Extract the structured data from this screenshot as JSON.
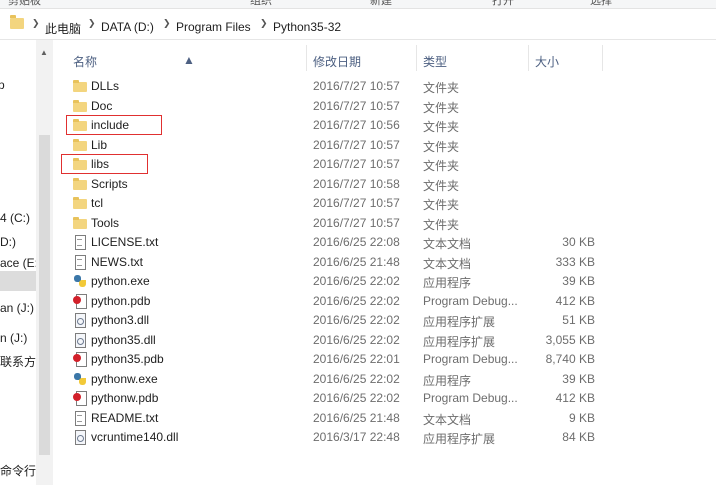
{
  "ribbon": {
    "groups": [
      "剪贴板",
      "组织",
      "新建",
      "打开",
      "选择"
    ]
  },
  "address_bar": {
    "folder_icon": "folder-icon",
    "breadcrumb": [
      "此电脑",
      "DATA (D:)",
      "Program Files",
      "Python35-32"
    ]
  },
  "nav_pane": {
    "items": [
      "p",
      "4 (C:)",
      "D:)",
      "ace (E:)",
      "an (J:)",
      "n (J:)",
      "联系方式",
      "命令行自"
    ]
  },
  "columns": {
    "name": "名称",
    "date": "修改日期",
    "type": "类型",
    "size": "大小"
  },
  "files": [
    {
      "name": "DLLs",
      "date": "2016/7/27 10:57",
      "type": "文件夹",
      "size": "",
      "icon": "folder"
    },
    {
      "name": "Doc",
      "date": "2016/7/27 10:57",
      "type": "文件夹",
      "size": "",
      "icon": "folder"
    },
    {
      "name": "include",
      "date": "2016/7/27 10:56",
      "type": "文件夹",
      "size": "",
      "icon": "folder"
    },
    {
      "name": "Lib",
      "date": "2016/7/27 10:57",
      "type": "文件夹",
      "size": "",
      "icon": "folder"
    },
    {
      "name": "libs",
      "date": "2016/7/27 10:57",
      "type": "文件夹",
      "size": "",
      "icon": "folder"
    },
    {
      "name": "Scripts",
      "date": "2016/7/27 10:58",
      "type": "文件夹",
      "size": "",
      "icon": "folder"
    },
    {
      "name": "tcl",
      "date": "2016/7/27 10:57",
      "type": "文件夹",
      "size": "",
      "icon": "folder"
    },
    {
      "name": "Tools",
      "date": "2016/7/27 10:57",
      "type": "文件夹",
      "size": "",
      "icon": "folder"
    },
    {
      "name": "LICENSE.txt",
      "date": "2016/6/25 22:08",
      "type": "文本文档",
      "size": "30 KB",
      "icon": "doc"
    },
    {
      "name": "NEWS.txt",
      "date": "2016/6/25 21:48",
      "type": "文本文档",
      "size": "333 KB",
      "icon": "doc"
    },
    {
      "name": "python.exe",
      "date": "2016/6/25 22:02",
      "type": "应用程序",
      "size": "39 KB",
      "icon": "py"
    },
    {
      "name": "python.pdb",
      "date": "2016/6/25 22:02",
      "type": "Program Debug...",
      "size": "412 KB",
      "icon": "pdb"
    },
    {
      "name": "python3.dll",
      "date": "2016/6/25 22:02",
      "type": "应用程序扩展",
      "size": "51 KB",
      "icon": "dll"
    },
    {
      "name": "python35.dll",
      "date": "2016/6/25 22:02",
      "type": "应用程序扩展",
      "size": "3,055 KB",
      "icon": "dll"
    },
    {
      "name": "python35.pdb",
      "date": "2016/6/25 22:01",
      "type": "Program Debug...",
      "size": "8,740 KB",
      "icon": "pdb"
    },
    {
      "name": "pythonw.exe",
      "date": "2016/6/25 22:02",
      "type": "应用程序",
      "size": "39 KB",
      "icon": "py"
    },
    {
      "name": "pythonw.pdb",
      "date": "2016/6/25 22:02",
      "type": "Program Debug...",
      "size": "412 KB",
      "icon": "pdb"
    },
    {
      "name": "README.txt",
      "date": "2016/6/25 21:48",
      "type": "文本文档",
      "size": "9 KB",
      "icon": "doc"
    },
    {
      "name": "vcruntime140.dll",
      "date": "2016/3/17 22:48",
      "type": "应用程序扩展",
      "size": "84 KB",
      "icon": "dll"
    }
  ],
  "highlighted": [
    "include",
    "libs"
  ],
  "colors": {
    "highlight_box": "#e03030",
    "folder": "#f3d57f",
    "header_text": "#4d6082"
  }
}
